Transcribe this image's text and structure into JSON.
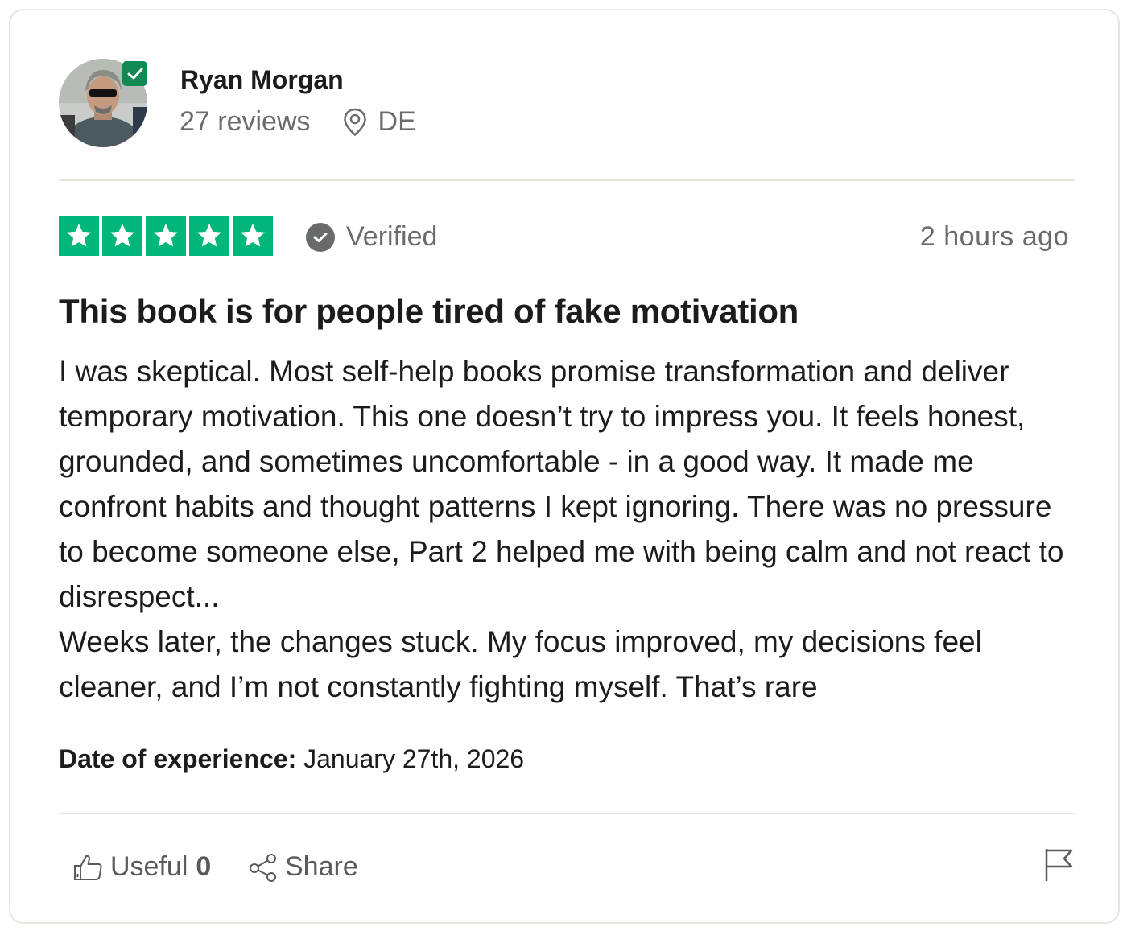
{
  "reviewer": {
    "name": "Ryan Morgan",
    "reviews_count": "27 reviews",
    "country": "DE"
  },
  "review": {
    "rating": 5,
    "verified_label": "Verified",
    "time_ago": "2 hours ago",
    "title": "This book is for people tired of fake motivation",
    "paragraph_1": "I was skeptical. Most self-help books promise transformation and deliver temporary motivation. This one doesn’t try to impress you. It feels honest, grounded, and sometimes uncomfortable - in a good way. It made me confront habits and thought patterns I kept ignoring. There was no pressure to become someone else, Part 2 helped me with being calm and not react to disrespect...",
    "paragraph_2": "Weeks later, the changes stuck. My focus improved, my decisions feel cleaner, and I’m not constantly fighting myself. That’s rare",
    "date_label": "Date of experience:",
    "date_value": "January 27th, 2026"
  },
  "actions": {
    "useful_label": "Useful",
    "useful_count": "0",
    "share_label": "Share"
  },
  "colors": {
    "star_green": "#00b67a",
    "badge_green": "#0f8a52",
    "muted_text": "#6b6b6b"
  },
  "icons": [
    "avatar",
    "verified-badge-icon",
    "location-pin-icon",
    "star-icon",
    "check-circle-icon",
    "thumbs-up-icon",
    "share-icon",
    "flag-icon"
  ]
}
